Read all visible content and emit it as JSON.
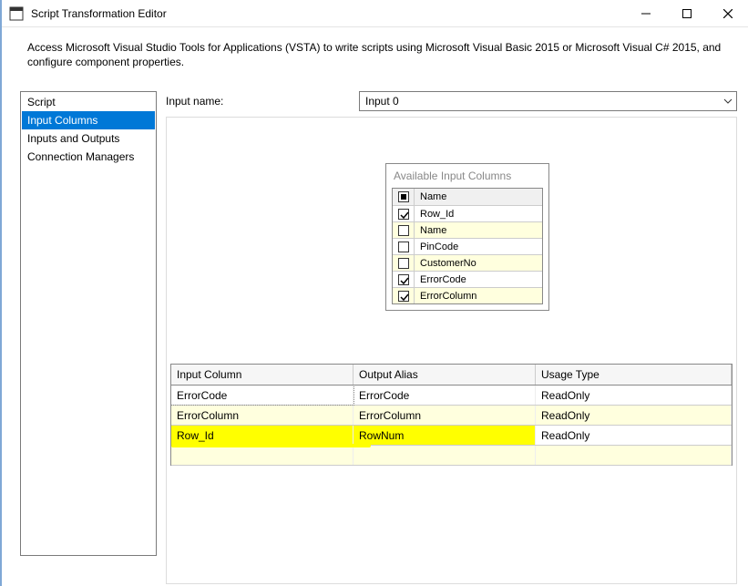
{
  "window": {
    "title": "Script Transformation Editor"
  },
  "description": "Access Microsoft Visual Studio Tools for Applications (VSTA) to write scripts using Microsoft Visual Basic 2015 or Microsoft Visual C# 2015, and configure component properties.",
  "nav": {
    "items": [
      {
        "label": "Script",
        "selected": false
      },
      {
        "label": "Input Columns",
        "selected": true
      },
      {
        "label": "Inputs and Outputs",
        "selected": false
      },
      {
        "label": "Connection Managers",
        "selected": false
      }
    ]
  },
  "inputName": {
    "label": "Input name:",
    "value": "Input 0"
  },
  "availableColumns": {
    "title": "Available Input Columns",
    "header": "Name",
    "rows": [
      {
        "label": "Row_Id",
        "checked": true
      },
      {
        "label": "Name",
        "checked": false
      },
      {
        "label": "PinCode",
        "checked": false
      },
      {
        "label": "CustomerNo",
        "checked": false
      },
      {
        "label": "ErrorCode",
        "checked": true
      },
      {
        "label": "ErrorColumn",
        "checked": true
      }
    ]
  },
  "selectedColumns": {
    "headers": {
      "input": "Input Column",
      "alias": "Output Alias",
      "usage": "Usage Type"
    },
    "rows": [
      {
        "input": "ErrorCode",
        "alias": "ErrorCode",
        "usage": "ReadOnly",
        "highlight": false
      },
      {
        "input": "ErrorColumn",
        "alias": "ErrorColumn",
        "usage": "ReadOnly",
        "highlight": false
      },
      {
        "input": "Row_Id",
        "alias": "RowNum",
        "usage": "ReadOnly",
        "highlight": true
      }
    ]
  }
}
